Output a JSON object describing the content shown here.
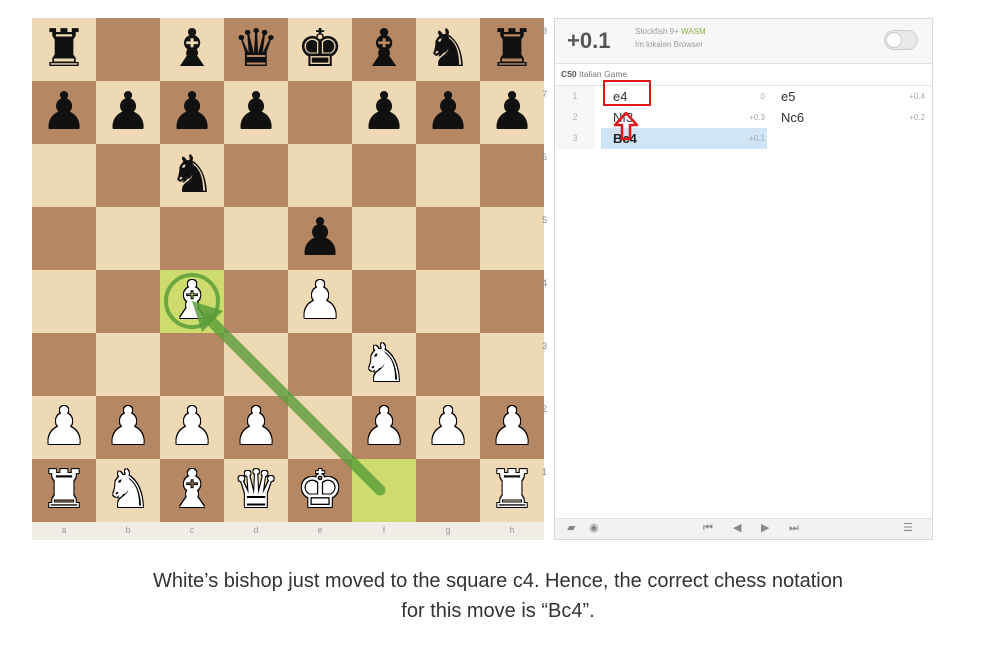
{
  "board": {
    "files": [
      "a",
      "b",
      "c",
      "d",
      "e",
      "f",
      "g",
      "h"
    ],
    "ranks": [
      "8",
      "7",
      "6",
      "5",
      "4",
      "3",
      "2",
      "1"
    ],
    "highlighted_squares": [
      "c4",
      "f1"
    ],
    "last_move": {
      "from": "f1",
      "to": "c4"
    },
    "pieces": [
      {
        "square": "a8",
        "color": "b",
        "symbol": "♜",
        "name": "black-rook-icon"
      },
      {
        "square": "c8",
        "color": "b",
        "symbol": "♝",
        "name": "black-bishop-icon"
      },
      {
        "square": "d8",
        "color": "b",
        "symbol": "♛",
        "name": "black-queen-icon"
      },
      {
        "square": "e8",
        "color": "b",
        "symbol": "♚",
        "name": "black-king-icon"
      },
      {
        "square": "f8",
        "color": "b",
        "symbol": "♝",
        "name": "black-bishop-icon"
      },
      {
        "square": "g8",
        "color": "b",
        "symbol": "♞",
        "name": "black-knight-icon"
      },
      {
        "square": "h8",
        "color": "b",
        "symbol": "♜",
        "name": "black-rook-icon"
      },
      {
        "square": "a7",
        "color": "b",
        "symbol": "♟",
        "name": "black-pawn-icon"
      },
      {
        "square": "b7",
        "color": "b",
        "symbol": "♟",
        "name": "black-pawn-icon"
      },
      {
        "square": "c7",
        "color": "b",
        "symbol": "♟",
        "name": "black-pawn-icon"
      },
      {
        "square": "d7",
        "color": "b",
        "symbol": "♟",
        "name": "black-pawn-icon"
      },
      {
        "square": "f7",
        "color": "b",
        "symbol": "♟",
        "name": "black-pawn-icon"
      },
      {
        "square": "g7",
        "color": "b",
        "symbol": "♟",
        "name": "black-pawn-icon"
      },
      {
        "square": "h7",
        "color": "b",
        "symbol": "♟",
        "name": "black-pawn-icon"
      },
      {
        "square": "c6",
        "color": "b",
        "symbol": "♞",
        "name": "black-knight-icon"
      },
      {
        "square": "e5",
        "color": "b",
        "symbol": "♟",
        "name": "black-pawn-icon"
      },
      {
        "square": "c4",
        "color": "w",
        "symbol": "♝",
        "name": "white-bishop-icon"
      },
      {
        "square": "e4",
        "color": "w",
        "symbol": "♟",
        "name": "white-pawn-icon"
      },
      {
        "square": "f3",
        "color": "w",
        "symbol": "♞",
        "name": "white-knight-icon"
      },
      {
        "square": "a2",
        "color": "w",
        "symbol": "♟",
        "name": "white-pawn-icon"
      },
      {
        "square": "b2",
        "color": "w",
        "symbol": "♟",
        "name": "white-pawn-icon"
      },
      {
        "square": "c2",
        "color": "w",
        "symbol": "♟",
        "name": "white-pawn-icon"
      },
      {
        "square": "d2",
        "color": "w",
        "symbol": "♟",
        "name": "white-pawn-icon"
      },
      {
        "square": "f2",
        "color": "w",
        "symbol": "♟",
        "name": "white-pawn-icon"
      },
      {
        "square": "g2",
        "color": "w",
        "symbol": "♟",
        "name": "white-pawn-icon"
      },
      {
        "square": "h2",
        "color": "w",
        "symbol": "♟",
        "name": "white-pawn-icon"
      },
      {
        "square": "a1",
        "color": "w",
        "symbol": "♜",
        "name": "white-rook-icon"
      },
      {
        "square": "b1",
        "color": "w",
        "symbol": "♞",
        "name": "white-knight-icon"
      },
      {
        "square": "c1",
        "color": "w",
        "symbol": "♝",
        "name": "white-bishop-icon"
      },
      {
        "square": "d1",
        "color": "w",
        "symbol": "♛",
        "name": "white-queen-icon"
      },
      {
        "square": "e1",
        "color": "w",
        "symbol": "♚",
        "name": "white-king-icon"
      },
      {
        "square": "h1",
        "color": "w",
        "symbol": "♜",
        "name": "white-rook-icon"
      }
    ],
    "colors": {
      "light": "#efd9b4",
      "dark": "#b58863",
      "highlight": "#cddc6c",
      "arrow": "#5a9e3a"
    }
  },
  "engine": {
    "eval": "+0.1",
    "name": "Stockfish 9+",
    "tech": "WASM",
    "location": "Im lokalen Browser",
    "toggle_icon": "toggle-switch-icon"
  },
  "opening": {
    "eco": "C50",
    "name": "Italian Game"
  },
  "moves": [
    {
      "num": "1",
      "white": "e4",
      "white_eval": "0",
      "black": "e5",
      "black_eval": "+0.4"
    },
    {
      "num": "2",
      "white": "Nf3",
      "white_eval": "+0.3",
      "black": "Nc6",
      "black_eval": "+0.2"
    },
    {
      "num": "3",
      "white": "Bc4",
      "white_eval": "+0.1",
      "black": "",
      "black_eval": ""
    }
  ],
  "active_move": "Bc4",
  "annotation": {
    "box_color": "#e0161b",
    "arrow_icon": "up-arrow-icon"
  },
  "controls": [
    "book-icon",
    "eye-icon",
    "first-move-icon",
    "prev-move-icon",
    "next-move-icon",
    "last-move-icon",
    "menu-icon"
  ],
  "caption": {
    "line1": "White’s bishop just moved to the square c4. Hence, the correct chess notation",
    "line2": "for this move is “Bc4”."
  }
}
